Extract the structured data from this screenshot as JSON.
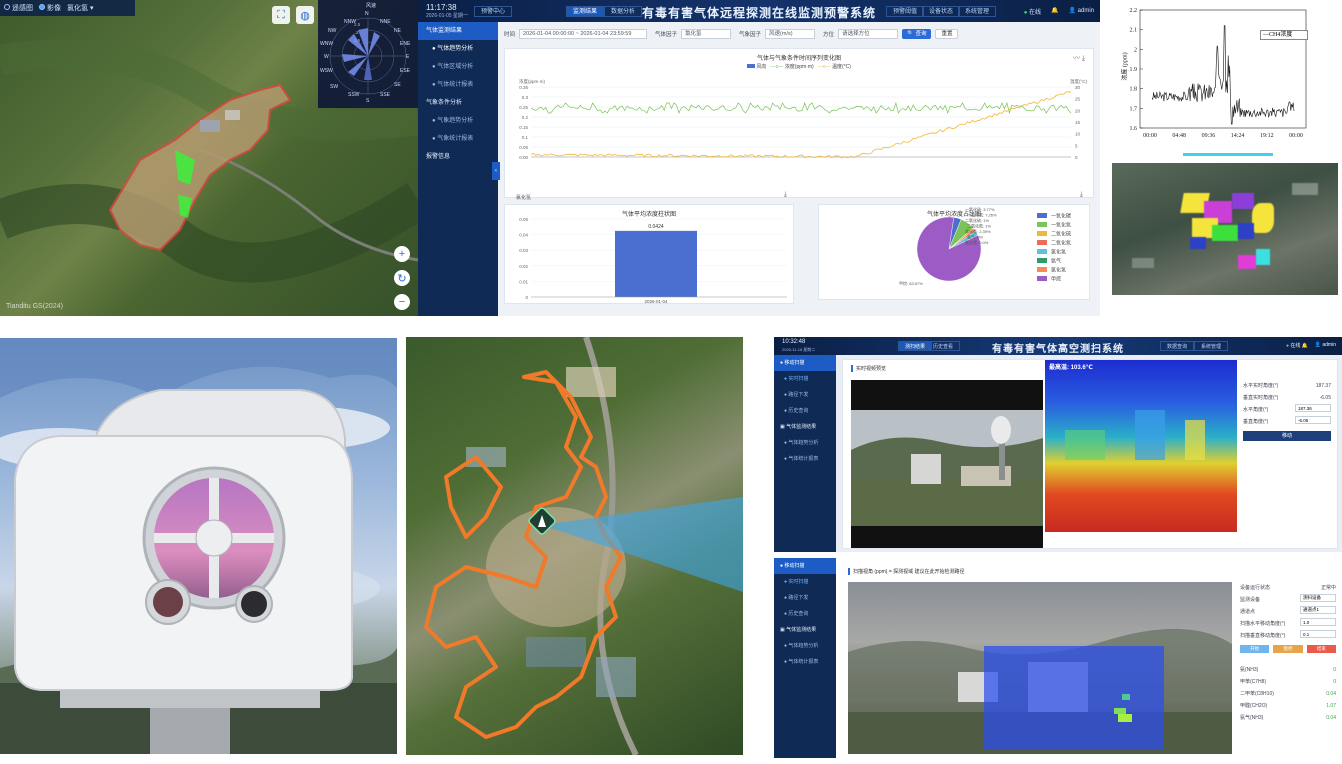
{
  "map1": {
    "layers": [
      "遥感图",
      "影像",
      "氯化氢"
    ],
    "active_layer": "影像",
    "watermark": "Tianditu GS(2024)",
    "wind_legend": "风速",
    "compass": [
      "N",
      "NNE",
      "NE",
      "ENE",
      "E",
      "ESE",
      "SE",
      "SSE",
      "S",
      "SSW",
      "SW",
      "WSW",
      "W",
      "WNW",
      "NW",
      "NNW"
    ],
    "rose_ticks": [
      "2.5",
      "2",
      "1.5"
    ]
  },
  "dashboard": {
    "time": "11:17:38",
    "date": "2026-01-05 星期一",
    "title": "有毒有害气体远程探测在线监测预警系统",
    "nav_left": [
      "预警中心",
      "监测结果",
      "数据分析"
    ],
    "nav_right": [
      "预警阈值",
      "设备状态",
      "系统管理"
    ],
    "online": "在线",
    "user": "admin",
    "sidebar": [
      {
        "label": "气体监测结果",
        "type": "group",
        "active": true
      },
      {
        "label": "气体趋势分析",
        "type": "sub",
        "active": true
      },
      {
        "label": "气体区域分析",
        "type": "sub",
        "active": false
      },
      {
        "label": "气体统计报表",
        "type": "sub",
        "active": false
      },
      {
        "label": "气象条件分析",
        "type": "group",
        "active": false
      },
      {
        "label": "气象趋势分析",
        "type": "sub",
        "active": false
      },
      {
        "label": "气象统计报表",
        "type": "sub",
        "active": false
      },
      {
        "label": "报警信息",
        "type": "group",
        "active": false
      }
    ],
    "filters": {
      "time_label": "时间",
      "time_value": "2026-01-04 00:00:00 ~ 2026-01-04 23:59:59",
      "gas_label": "气体因子",
      "gas_value": "氯化氢",
      "met_label": "气象因子",
      "met_value": "风速(m/s)",
      "dir_label": "方位",
      "dir_value": "请选择方位",
      "query": "查询",
      "reset": "重置"
    },
    "trend_chart": {
      "title": "气体与气象条件时间序列变化图",
      "legend": [
        "风向",
        "浓度(ppm·m)",
        "温度(°C)"
      ],
      "left_axis": "浓度(ppm·m)",
      "right_axis": "温度(°C)",
      "y_left_ticks": [
        "0.35",
        "0.3",
        "0.25",
        "0.2",
        "0.15",
        "0.1",
        "0.05",
        "0.00"
      ],
      "y_right_ticks": [
        "30",
        "25",
        "20",
        "15",
        "10",
        "5",
        "0"
      ],
      "colors": {
        "bar": "#4a6fd0",
        "gas": "#7cc35a",
        "temp": "#f0b83a"
      }
    },
    "bar_chart": {
      "title": "气体平均浓度柱状图",
      "unit": "氯化氢",
      "value_label": "0.0424",
      "category": "2026-01-04",
      "y_ticks": [
        "0.05",
        "0.04",
        "0.03",
        "0.02",
        "0.01",
        "0"
      ]
    },
    "pie_chart": {
      "title": "气体平均浓度占比图",
      "slices": [
        {
          "label": "一氧化碳",
          "value": 3.77,
          "color": "#4a6fd0"
        },
        {
          "label": "一氧化氮",
          "value": 7.26,
          "color": "#7cc35a"
        },
        {
          "label": "二氧化硫",
          "value": 1.0,
          "color": "#f0b83a"
        },
        {
          "label": "二氧化氮",
          "value": 1.0,
          "color": "#ee6a5a"
        },
        {
          "label": "氯化氢",
          "value": 2.39,
          "color": "#5fc2dd"
        },
        {
          "label": "氨气",
          "value": 0.0,
          "color": "#2e9c6a"
        },
        {
          "label": "氯化氢",
          "value": 0.0,
          "color": "#f28b55"
        },
        {
          "label": "甲烷",
          "value": 83.57,
          "color": "#9c5bc5"
        }
      ],
      "callouts": [
        "一氧化碳: 3.77%",
        "一氧化氮: 7.26%",
        "二氧化硫: 1%",
        "二氧化氮: 1%",
        "氯化氢: 2.39%",
        "氨气: 0%",
        "氯化氢: 0.0%",
        "甲烷: 83.57%"
      ]
    }
  },
  "ch4_chart": {
    "legend": "CH4浓度",
    "ylabel": "浓度 (ppm)",
    "x_ticks": [
      "00:00",
      "04:48",
      "09:36",
      "14:24",
      "19:12",
      "00:00"
    ],
    "y_ticks": [
      "2.2",
      "2.1",
      "2",
      "1.9",
      "1.8",
      "1.7",
      "1.6"
    ]
  },
  "system": {
    "time": "10:32:48",
    "date": "2025-11-18 星期二",
    "title": "有毒有害气体高空测扫系统",
    "nav_left": [
      "测扫结果",
      "历史查看"
    ],
    "nav_right": [
      "数据查询",
      "系统管理"
    ],
    "online": "在线",
    "user": "admin",
    "sidebar": [
      {
        "label": "移动扫描",
        "type": "group",
        "active": true
      },
      {
        "label": "实时扫描",
        "type": "sub",
        "active": true
      },
      {
        "label": "路径下发",
        "type": "sub",
        "active": false
      },
      {
        "label": "历史查询",
        "type": "sub",
        "active": false
      },
      {
        "label": "气体监测结果",
        "type": "group",
        "active": false
      },
      {
        "label": "气体趋势分析",
        "type": "sub",
        "active": false
      },
      {
        "label": "气体统计报表",
        "type": "sub",
        "active": false
      }
    ],
    "panel1": {
      "header": "实时视频预览",
      "thermal_label": "最高温: 103.6℃",
      "fields": [
        {
          "label": "水平实时角度(°)",
          "value": "187.37"
        },
        {
          "label": "垂直实时角度(°)",
          "value": "-6.05"
        },
        {
          "label": "水平角度(°)",
          "value": "187.36"
        },
        {
          "label": "垂直角度(°)",
          "value": "-6.05"
        }
      ],
      "move_button": "移动"
    },
    "panel2": {
      "header": "扫描视角 (ppm) = 探测视域 建议在此开始检测路径",
      "fields": [
        {
          "label": "设备运行状态",
          "value": "正常中"
        },
        {
          "label": "监测设备",
          "value": "测扫设备"
        },
        {
          "label": "通道点",
          "value": "通道点1"
        },
        {
          "label": "扫描水平移动角度(°)",
          "value": "1.0"
        },
        {
          "label": "扫描垂直移动角度(°)",
          "value": "0.1"
        }
      ],
      "buttons": [
        "开始",
        "暂停",
        "结束"
      ],
      "gas_readings": [
        {
          "label": "氨(NH3)",
          "value": "0"
        },
        {
          "label": "甲苯(C7H8)",
          "value": "0"
        },
        {
          "label": "二甲苯(C8H10)",
          "value": "0.04"
        },
        {
          "label": "甲醛(CH2O)",
          "value": "1.07"
        },
        {
          "label": "氨气(NH3)",
          "value": "0.04"
        }
      ]
    }
  }
}
